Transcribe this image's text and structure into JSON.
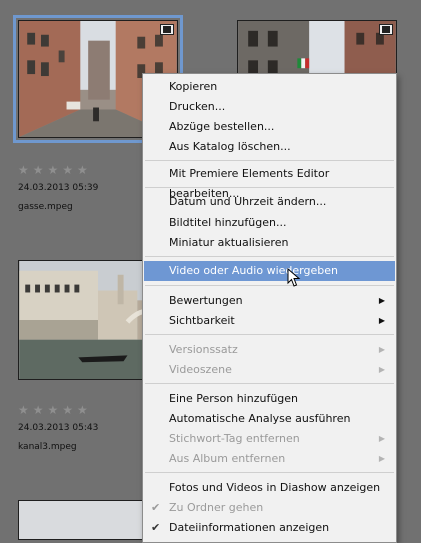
{
  "thumbnails": [
    {
      "name": "thumb-gasse",
      "stars": "★★★★★",
      "date": "24.03.2013 05:39",
      "file": "gasse.mpeg",
      "video": true,
      "selected": true
    },
    {
      "name": "thumb-street-2",
      "video": true,
      "selected": false
    },
    {
      "name": "thumb-kanal3",
      "stars": "★★★★★",
      "date": "24.03.2013 05:43",
      "file": "kanal3.mpeg",
      "video": false,
      "selected": false
    }
  ],
  "menu": {
    "items": [
      {
        "label": "Kopieren"
      },
      {
        "label": "Drucken..."
      },
      {
        "label": "Abzüge bestellen..."
      },
      {
        "label": "Aus Katalog löschen..."
      },
      {
        "label": "Mit Premiere Elements Editor bearbeiten..."
      },
      {
        "label": "Datum und Uhrzeit ändern..."
      },
      {
        "label": "Bildtitel hinzufügen..."
      },
      {
        "label": "Miniatur aktualisieren"
      },
      {
        "label": "Video oder Audio wiedergeben"
      },
      {
        "label": "Bewertungen"
      },
      {
        "label": "Sichtbarkeit"
      },
      {
        "label": "Versionssatz"
      },
      {
        "label": "Videoszene"
      },
      {
        "label": "Eine Person hinzufügen"
      },
      {
        "label": "Automatische Analyse ausführen"
      },
      {
        "label": "Stichwort-Tag entfernen"
      },
      {
        "label": "Aus Album entfernen"
      },
      {
        "label": "Fotos und Videos in Diashow anzeigen"
      },
      {
        "label": "Zu Ordner gehen"
      },
      {
        "label": "Dateiinformationen anzeigen"
      }
    ],
    "highlighted_index": 8,
    "submenu_arrow": "▶",
    "checkmark": "✔"
  },
  "colors": {
    "background": "#717171",
    "menu_background": "#f1f1f1",
    "highlight": "#6e97d3",
    "selection_frame": "#6f98cf",
    "disabled_text": "#9a9a9a"
  }
}
